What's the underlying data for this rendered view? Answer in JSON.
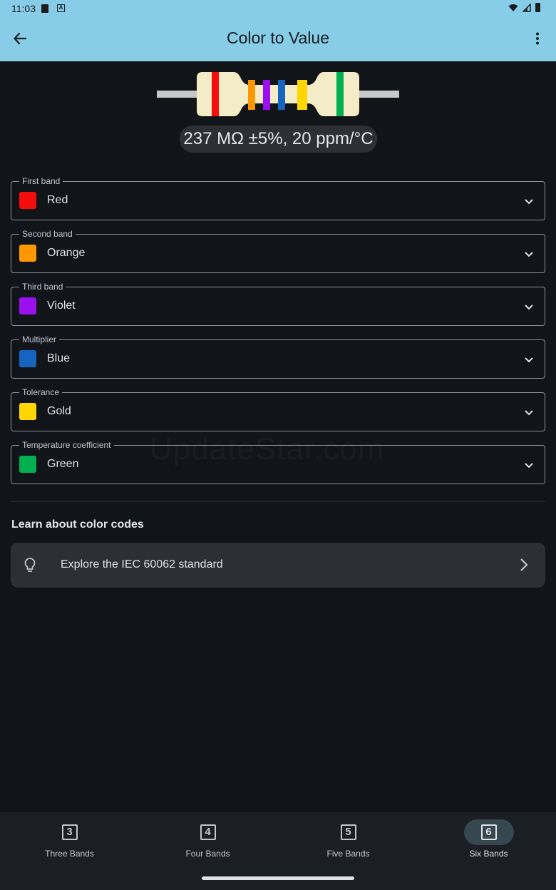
{
  "status_bar": {
    "time": "11:03"
  },
  "app_bar": {
    "title": "Color to Value"
  },
  "resistor": {
    "bands": [
      "#f50c0c",
      "#ff9800",
      "#9c10f0",
      "#1565c0",
      "#ffd600",
      "#00b050"
    ],
    "body_color": "#f4ecc6",
    "lead_color": "#c8c8c8"
  },
  "result": {
    "text": "237 MΩ ±5%, 20 ppm/°C"
  },
  "fields": [
    {
      "label": "First band",
      "value": "Red",
      "color": "#f50c0c"
    },
    {
      "label": "Second band",
      "value": "Orange",
      "color": "#ff9800"
    },
    {
      "label": "Third band",
      "value": "Violet",
      "color": "#9c10f0"
    },
    {
      "label": "Multiplier",
      "value": "Blue",
      "color": "#1565c0"
    },
    {
      "label": "Tolerance",
      "value": "Gold",
      "color": "#ffd600"
    },
    {
      "label": "Temperature coefficient",
      "value": "Green",
      "color": "#00b050"
    }
  ],
  "learn": {
    "heading": "Learn about color codes",
    "card_text": "Explore the IEC 60062 standard"
  },
  "watermark": "UpdateStar.com",
  "bottom_nav": [
    {
      "icon_digit": "3",
      "label": "Three Bands"
    },
    {
      "icon_digit": "4",
      "label": "Four Bands"
    },
    {
      "icon_digit": "5",
      "label": "Five Bands"
    },
    {
      "icon_digit": "6",
      "label": "Six Bands",
      "selected": true
    }
  ]
}
